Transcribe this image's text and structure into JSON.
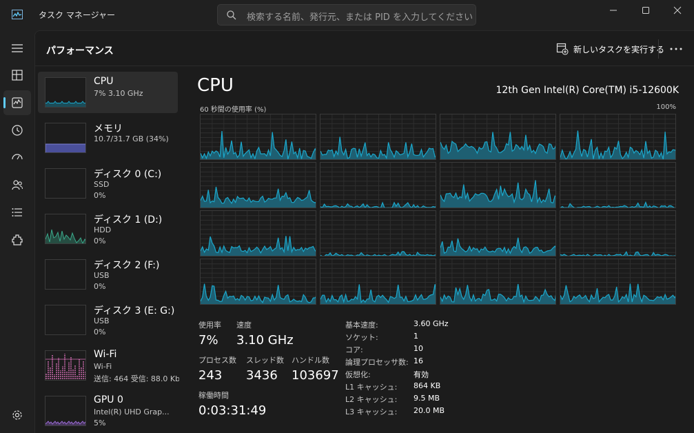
{
  "window": {
    "title": "タスク マネージャー",
    "search_placeholder": "検索する名前、発行元、または PID を入力してください"
  },
  "nav": {
    "items": [
      {
        "icon": "hamburger-icon"
      },
      {
        "icon": "processes-icon"
      },
      {
        "icon": "performance-icon"
      },
      {
        "icon": "app-history-icon"
      },
      {
        "icon": "startup-icon"
      },
      {
        "icon": "users-icon"
      },
      {
        "icon": "details-icon"
      },
      {
        "icon": "services-icon"
      }
    ],
    "settings_icon": "settings-icon"
  },
  "header": {
    "page_title": "パフォーマンス",
    "run_task_label": "新しいタスクを実行する"
  },
  "resources": [
    {
      "name": "CPU",
      "line1": "7%  3.10 GHz",
      "line2": "",
      "line3": "",
      "color": "#1ba8cc"
    },
    {
      "name": "メモリ",
      "line1": "10.7/31.7 GB (34%)",
      "line2": "",
      "line3": "",
      "color": "#7d82d6"
    },
    {
      "name": "ディスク 0 (C:)",
      "line1": "SSD",
      "line2": "0%",
      "line3": "",
      "color": "#3aa88a"
    },
    {
      "name": "ディスク 1 (D:)",
      "line1": "HDD",
      "line2": "0%",
      "line3": "",
      "color": "#3aa88a"
    },
    {
      "name": "ディスク 2 (F:)",
      "line1": "USB",
      "line2": "0%",
      "line3": "",
      "color": "#3aa88a"
    },
    {
      "name": "ディスク 3 (E: G:)",
      "line1": "USB",
      "line2": "0%",
      "line3": "",
      "color": "#3aa88a"
    },
    {
      "name": "Wi-Fi",
      "line1": "Wi-Fi",
      "line2": "送信: 464 受信: 88.0 Kbps",
      "line3": "",
      "color": "#d86fb8"
    },
    {
      "name": "GPU 0",
      "line1": "Intel(R) UHD Grap...",
      "line2": "5%",
      "line3": "",
      "color": "#9b6bd6"
    }
  ],
  "detail": {
    "title": "CPU",
    "model": "12th Gen Intel(R) Core(TM) i5-12600K",
    "graph_label": "60 秒間の使用率 (%)",
    "graph_max": "100%",
    "stats": {
      "usage_label": "使用率",
      "usage_value": "7%",
      "speed_label": "速度",
      "speed_value": "3.10 GHz",
      "processes_label": "プロセス数",
      "processes_value": "243",
      "threads_label": "スレッド数",
      "threads_value": "3436",
      "handles_label": "ハンドル数",
      "handles_value": "103697",
      "uptime_label": "稼働時間",
      "uptime_value": "0:03:31:49"
    },
    "specs": [
      {
        "k": "基本速度:",
        "v": "3.60 GHz"
      },
      {
        "k": "ソケット:",
        "v": "1"
      },
      {
        "k": "コア:",
        "v": "10"
      },
      {
        "k": "論理プロセッサ数:",
        "v": "16"
      },
      {
        "k": "仮想化:",
        "v": "有効"
      },
      {
        "k": "L1 キャッシュ:",
        "v": "864 KB"
      },
      {
        "k": "L2 キャッシュ:",
        "v": "9.5 MB"
      },
      {
        "k": "L3 キャッシュ:",
        "v": "20.0 MB"
      }
    ]
  },
  "colors": {
    "accent": "#60cdff",
    "cpu_line": "#1ba8cc",
    "cpu_fill": "#1e5f72",
    "grid_line": "#2e2e2e",
    "background": "#1c1c1c"
  }
}
